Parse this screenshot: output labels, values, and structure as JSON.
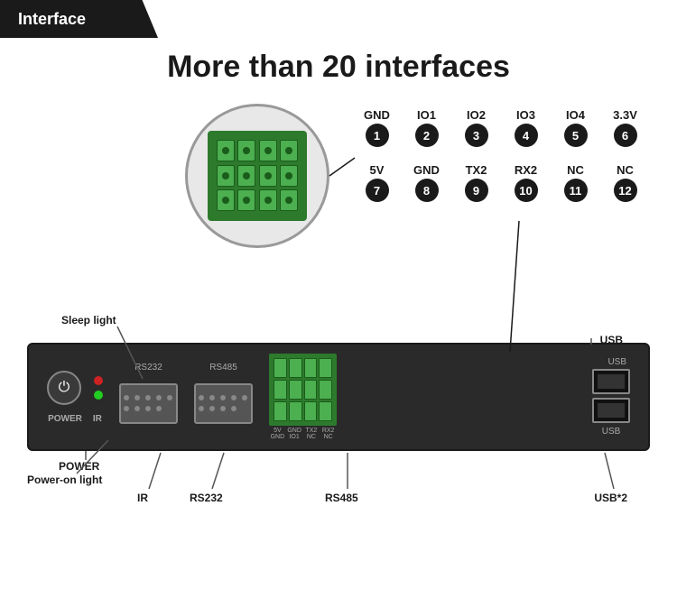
{
  "header": {
    "tab_label": "Interface"
  },
  "main": {
    "title": "More than 20 interfaces"
  },
  "pin_grid": {
    "row1": [
      {
        "name": "GND",
        "number": "1"
      },
      {
        "name": "IO1",
        "number": "2"
      },
      {
        "name": "IO2",
        "number": "3"
      },
      {
        "name": "IO3",
        "number": "4"
      },
      {
        "name": "IO4",
        "number": "5"
      },
      {
        "name": "3.3V",
        "number": "6"
      }
    ],
    "row2": [
      {
        "name": "5V",
        "number": "7"
      },
      {
        "name": "GND",
        "number": "8"
      },
      {
        "name": "TX2",
        "number": "9"
      },
      {
        "name": "RX2",
        "number": "10"
      },
      {
        "name": "NC",
        "number": "11"
      },
      {
        "name": "NC",
        "number": "12"
      }
    ]
  },
  "device": {
    "labels": {
      "power": "POWER",
      "power_on_light": "Power-on light",
      "sleep_light": "Sleep light",
      "ir": "IR",
      "rs232": "RS232",
      "rs485": "RS485",
      "usb_count": "USB*2"
    },
    "port_labels": {
      "rs232_top": "RS232",
      "rs485_top": "RS485",
      "usb_top": "USB",
      "usb_label": "USB"
    }
  }
}
